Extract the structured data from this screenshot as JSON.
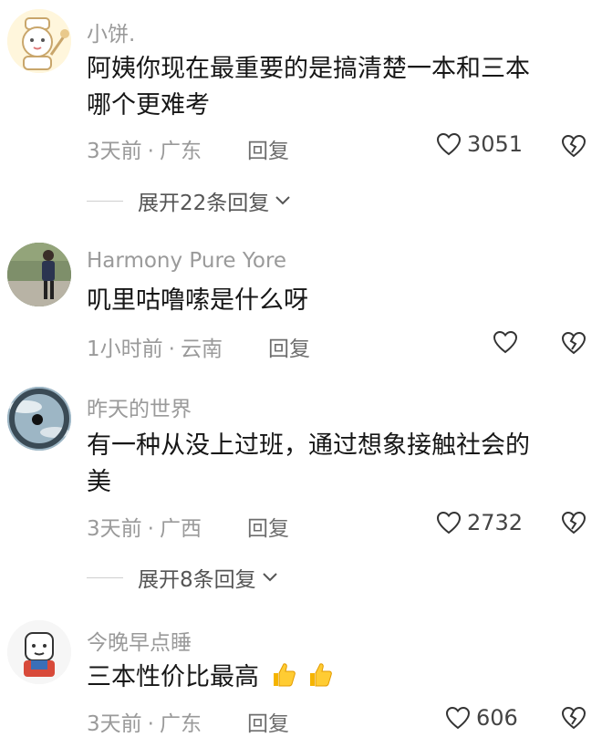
{
  "comments": [
    {
      "username": "小饼.",
      "text_line1": "阿姨你现在最重要的是搞清楚一本和三本",
      "text_line2": "哪个更难考",
      "time": "3天前",
      "location": "广东",
      "reply": "回复",
      "likes": "3051",
      "expand": "展开22条回复",
      "avatar_icon": "chef-cat-avatar"
    },
    {
      "username": "Harmony Pure Yore",
      "text_line1": "叽里咕噜嗦是什么呀",
      "time": "1小时前",
      "location": "云南",
      "reply": "回复",
      "avatar_icon": "person-walking-avatar"
    },
    {
      "username": "昨天的世界",
      "text_line1": "有一种从没上过班，通过想象接触社会的",
      "text_line2": "美",
      "time": "3天前",
      "location": "广西",
      "reply": "回复",
      "likes": "2732",
      "expand": "展开8条回复",
      "avatar_icon": "sky-eye-avatar"
    },
    {
      "username": "今晚早点睡",
      "text_line1": "三本性价比最高",
      "time": "3天前",
      "location": "广东",
      "reply": "回复",
      "likes": "606",
      "avatar_icon": "cartoon-avatar"
    }
  ],
  "separator": "·"
}
